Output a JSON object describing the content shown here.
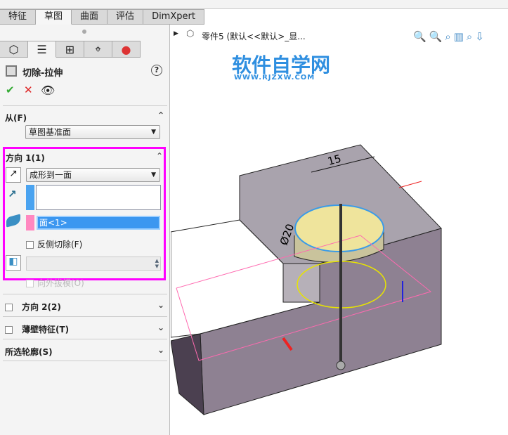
{
  "tabs": [
    "特征",
    "草图",
    "曲面",
    "评估",
    "DimXpert"
  ],
  "active_tab": "草图",
  "panel": {
    "title": "切除-拉伸",
    "help": "?",
    "from": {
      "label": "从(F)",
      "value": "草图基准面"
    },
    "direction1": {
      "label": "方向 1(1)",
      "end_condition": "成形到一面",
      "face_value": "面<1>",
      "reverse_cut": "反侧切除(F)",
      "draft_outward": "向外拔模(O)"
    },
    "direction2": {
      "label": "方向 2(2)"
    },
    "thin_feature": {
      "label": "薄壁特征(T)"
    },
    "selected_contours": {
      "label": "所选轮廓(S)"
    }
  },
  "tree": {
    "root": "零件5 (默认<<默认>_显..."
  },
  "watermark": {
    "title": "软件自学网",
    "url": "WWW.RJZXW.COM"
  },
  "dimensions": {
    "width": "15",
    "diameter": "Ø20"
  },
  "colors": {
    "highlight": "#ff00ff",
    "selection": "#3399ff",
    "face_pink": "#ff88c0"
  }
}
